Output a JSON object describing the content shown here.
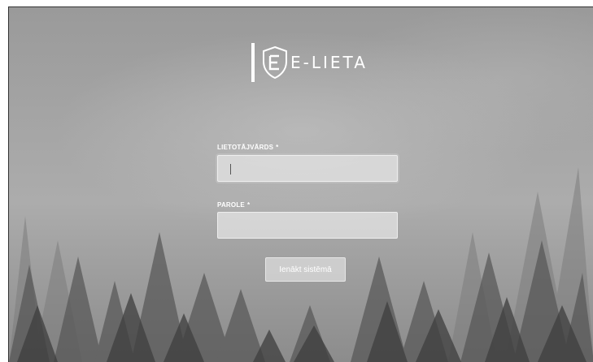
{
  "brand": {
    "logo_text": "E-LIETA"
  },
  "login_form": {
    "username": {
      "label": "LIETOTĀJVĀRDS",
      "required_mark": "*",
      "value": ""
    },
    "password": {
      "label": "PAROLE",
      "required_mark": "*",
      "value": ""
    },
    "submit_label": "Ienākt sistēmā"
  },
  "colors": {
    "text": "#ffffff",
    "input_bg": "#e1e1e1",
    "background": "#a0a0a0"
  }
}
